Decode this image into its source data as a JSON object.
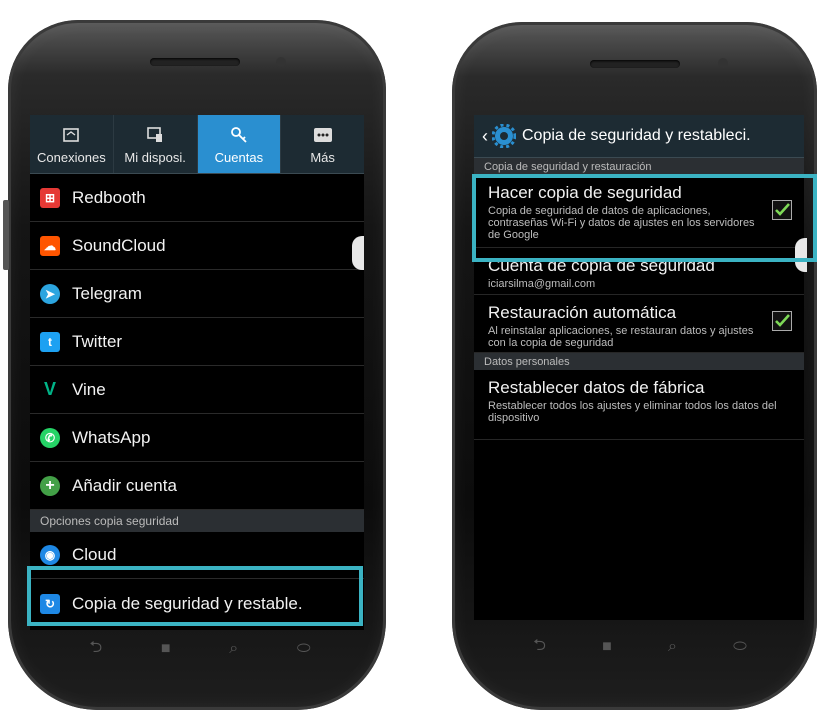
{
  "left": {
    "tabs": [
      {
        "label": "Conexiones",
        "icon": "box-icon"
      },
      {
        "label": "Mi disposi.",
        "icon": "device-icon"
      },
      {
        "label": "Cuentas",
        "icon": "key-icon"
      },
      {
        "label": "Más",
        "icon": "more-icon"
      }
    ],
    "accounts": [
      {
        "label": "Redbooth",
        "icon_color": "#e53935"
      },
      {
        "label": "SoundCloud",
        "icon_color": "#ff5500"
      },
      {
        "label": "Telegram",
        "icon_color": "#2ca5e0"
      },
      {
        "label": "Twitter",
        "icon_color": "#1da1f2"
      },
      {
        "label": "Vine",
        "icon_color": "#00b488"
      },
      {
        "label": "WhatsApp",
        "icon_color": "#25d366"
      },
      {
        "label": "Añadir cuenta",
        "icon_color": "#43a047"
      }
    ],
    "section_backup": "Opciones copia seguridad",
    "cloud": "Cloud",
    "backup_reset": "Copia de seguridad y restable."
  },
  "right": {
    "header_title": "Copia de seguridad y restableci.",
    "section1": "Copia de seguridad y restauración",
    "item1_title": "Hacer copia de seguridad",
    "item1_sub": "Copia de seguridad de datos de aplicaciones, contraseñas Wi-Fi y datos de ajustes en los servidores de Google",
    "item2_title": "Cuenta de copia de seguridad",
    "item2_sub": "iciarsilma@gmail.com",
    "item3_title": "Restauración automática",
    "item3_sub": "Al reinstalar aplicaciones, se restauran datos y ajustes con la copia de seguridad",
    "section2": "Datos personales",
    "item4_title": "Restablecer datos de fábrica",
    "item4_sub": "Restablecer todos los ajustes y eliminar todos los datos del dispositivo"
  },
  "colors": {
    "highlight": "#3bb3c3",
    "accent": "#2a8fd0",
    "check": "#7ed957"
  }
}
